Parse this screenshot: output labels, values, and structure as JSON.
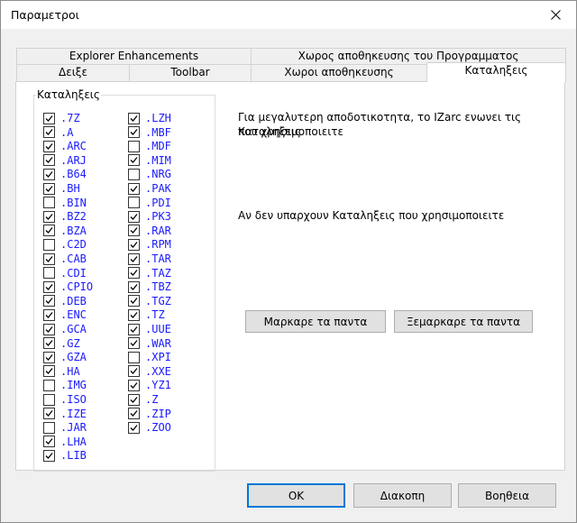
{
  "window": {
    "title": "Παραμετροι"
  },
  "tabs": {
    "explorer": "Explorer Enhancements",
    "program_storage": "Χωρος αποθηκευσης του Προγραμματος",
    "show": "Δειξε",
    "toolbar": "Toolbar",
    "storage": "Χωροι αποθηκευσης",
    "extensions": "Καταληξεις"
  },
  "extensions_group": {
    "title": "Καταληξεις",
    "column1": [
      {
        "label": ".7Z",
        "checked": true
      },
      {
        "label": ".A",
        "checked": true
      },
      {
        "label": ".ARC",
        "checked": true
      },
      {
        "label": ".ARJ",
        "checked": true
      },
      {
        "label": ".B64",
        "checked": true
      },
      {
        "label": ".BH",
        "checked": true
      },
      {
        "label": ".BIN",
        "checked": false
      },
      {
        "label": ".BZ2",
        "checked": true
      },
      {
        "label": ".BZA",
        "checked": true
      },
      {
        "label": ".C2D",
        "checked": false
      },
      {
        "label": ".CAB",
        "checked": true
      },
      {
        "label": ".CDI",
        "checked": false
      },
      {
        "label": ".CPIO",
        "checked": true
      },
      {
        "label": ".DEB",
        "checked": true
      },
      {
        "label": ".ENC",
        "checked": true
      },
      {
        "label": ".GCA",
        "checked": true
      },
      {
        "label": ".GZ",
        "checked": true
      },
      {
        "label": ".GZA",
        "checked": true
      },
      {
        "label": ".HA",
        "checked": true
      },
      {
        "label": ".IMG",
        "checked": false
      },
      {
        "label": ".ISO",
        "checked": false
      },
      {
        "label": ".IZE",
        "checked": true
      },
      {
        "label": ".JAR",
        "checked": false
      },
      {
        "label": ".LHA",
        "checked": true
      },
      {
        "label": ".LIB",
        "checked": true
      }
    ],
    "column2": [
      {
        "label": ".LZH",
        "checked": true
      },
      {
        "label": ".MBF",
        "checked": true
      },
      {
        "label": ".MDF",
        "checked": false
      },
      {
        "label": ".MIM",
        "checked": true
      },
      {
        "label": ".NRG",
        "checked": false
      },
      {
        "label": ".PAK",
        "checked": true
      },
      {
        "label": ".PDI",
        "checked": false
      },
      {
        "label": ".PK3",
        "checked": true
      },
      {
        "label": ".RAR",
        "checked": true
      },
      {
        "label": ".RPM",
        "checked": true
      },
      {
        "label": ".TAR",
        "checked": true
      },
      {
        "label": ".TAZ",
        "checked": true
      },
      {
        "label": ".TBZ",
        "checked": true
      },
      {
        "label": ".TGZ",
        "checked": true
      },
      {
        "label": ".TZ",
        "checked": true
      },
      {
        "label": ".UUE",
        "checked": true
      },
      {
        "label": ".WAR",
        "checked": true
      },
      {
        "label": ".XPI",
        "checked": false
      },
      {
        "label": ".XXE",
        "checked": true
      },
      {
        "label": ".YZ1",
        "checked": true
      },
      {
        "label": ".Z",
        "checked": true
      },
      {
        "label": ".ZIP",
        "checked": true
      },
      {
        "label": ".ZOO",
        "checked": true
      }
    ]
  },
  "description": {
    "line1": "Για μεγαλυτερη αποδοτικοτητα, το IZarc ενωνει τις Καταληξεις",
    "line2": "που χρησιμοποιειτε",
    "line3": "Αν δεν υπαρχουν Καταληξεις που χρησιμοποιειτε"
  },
  "panel_buttons": {
    "select_all": "Μαρκαρε τα παντα",
    "deselect_all": "Ξεμαρκαρε τα παντα"
  },
  "dialog_buttons": {
    "ok": "OK",
    "cancel": "Διακοπη",
    "help": "Βοηθεια"
  },
  "icons": {
    "close": "close-icon",
    "check": "check-icon"
  },
  "colors": {
    "extension_text": "#1a1aff",
    "default_button_border": "#0078d7"
  }
}
